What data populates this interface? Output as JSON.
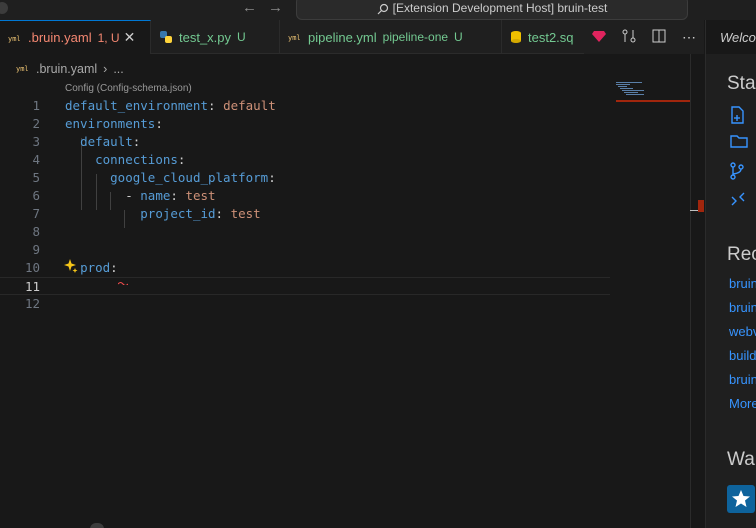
{
  "window": {
    "command_center": "[Extension Development Host] bruin-test"
  },
  "tabs": [
    {
      "name": ".bruin.yaml",
      "status": "1, U",
      "active": true,
      "color": "#f48771",
      "status_color": "#f48771"
    },
    {
      "name": "test_x.py",
      "status": "U",
      "active": false,
      "color": "#73c991",
      "status_color": "#73c991"
    },
    {
      "name": "pipeline.yml",
      "desc": "pipeline-one",
      "status": "U",
      "active": false,
      "color": "#73c991",
      "status_color": "#73c991"
    },
    {
      "name": "test2.sq",
      "active": false,
      "color": "#73c991"
    }
  ],
  "breadcrumb": {
    "file": ".bruin.yaml",
    "current": "..."
  },
  "editor": {
    "codelens": "Config (Config-schema.json)",
    "lines": [
      {
        "n": "1"
      },
      {
        "n": "2"
      },
      {
        "n": "3"
      },
      {
        "n": "4"
      },
      {
        "n": "5"
      },
      {
        "n": "6"
      },
      {
        "n": "7"
      },
      {
        "n": "8"
      },
      {
        "n": "9"
      },
      {
        "n": "10"
      },
      {
        "n": "11"
      },
      {
        "n": "12"
      }
    ],
    "tokens": {
      "l1k": "default_environment",
      "l1v": "default",
      "l2k": "environments",
      "l3k": "default",
      "l4k": "connections",
      "l5k": "google_cloud_platform",
      "l6d": "-",
      "l6k": "name",
      "l6v": "test",
      "l7k": "project_id",
      "l7v": "test",
      "l10k": "prod"
    }
  },
  "welcome": {
    "tab_label": "Welcome",
    "start_heading": "Start",
    "recent_heading": "Recent",
    "recent_items": [
      "bruin",
      "bruin",
      "webv",
      "build",
      "bruin"
    ],
    "more_link": "More...",
    "walkthroughs_heading": "Walkthroughs"
  },
  "colors": {
    "accent": "#0078d4",
    "error": "#a1260d",
    "key": "#569cd6",
    "string": "#ce9178",
    "link": "#3794ff"
  }
}
